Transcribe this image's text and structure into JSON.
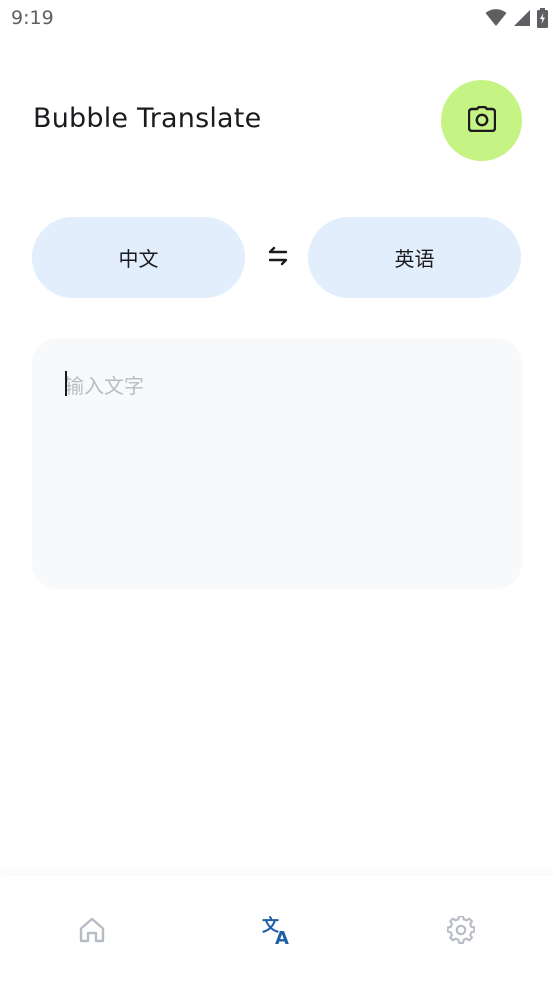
{
  "status_bar": {
    "time": "9:19",
    "icons": [
      "wifi-icon",
      "signal-icon",
      "battery-charging-icon"
    ]
  },
  "header": {
    "title": "Bubble Translate",
    "camera_button_icon": "camera-icon"
  },
  "languages": {
    "source": "中文",
    "target": "英语",
    "swap_icon": "swap-arrows-icon"
  },
  "input": {
    "value": "",
    "placeholder": "输入文字"
  },
  "bottom_nav": {
    "items": [
      {
        "icon": "home-icon",
        "active": false
      },
      {
        "icon": "translate-icon",
        "active": true
      },
      {
        "icon": "gear-icon",
        "active": false
      }
    ]
  },
  "colors": {
    "accent_fab": "#c5f384",
    "language_pill": "#e2eefc",
    "nav_active": "#1f5fa6",
    "nav_inactive": "#b8bcc4"
  }
}
